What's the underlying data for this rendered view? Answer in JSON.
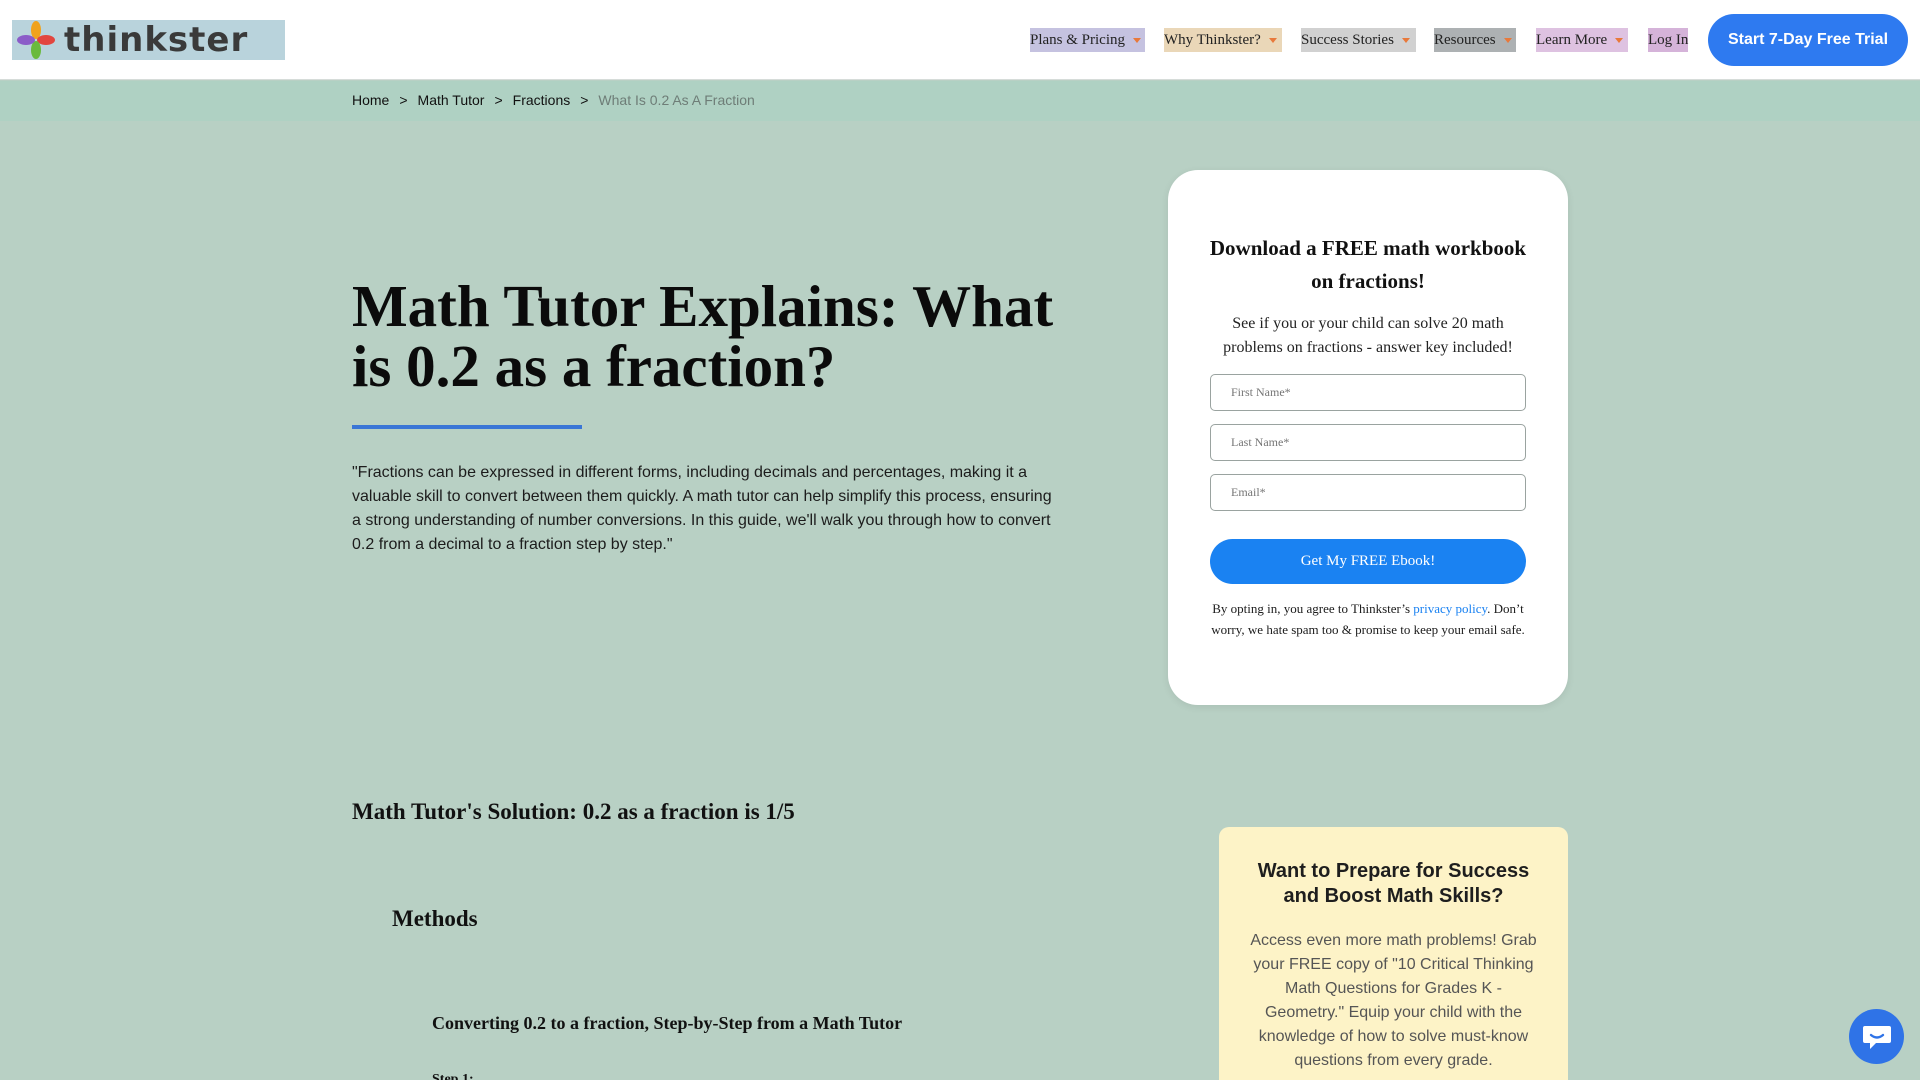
{
  "header": {
    "logo_text": "thinkster",
    "nav": [
      {
        "label": "Plans & Pricing"
      },
      {
        "label": "Why Thinkster?"
      },
      {
        "label": "Success Stories"
      },
      {
        "label": "Resources"
      },
      {
        "label": "Learn More"
      },
      {
        "label": "Log In"
      }
    ],
    "cta_label": "Start 7-Day Free Trial"
  },
  "breadcrumb": {
    "items": [
      "Home",
      "Math Tutor",
      "Fractions",
      "What Is 0.2 As A Fraction"
    ],
    "separator": ">"
  },
  "hero": {
    "title": "Math Tutor Explains: What is 0.2 as a fraction?",
    "description": "\"Fractions can be expressed in different forms, including decimals and percentages, making it a valuable skill to convert between them quickly. A math tutor can help simplify this process, ensuring a strong understanding of number conversions. In this guide, we'll walk you through how to convert 0.2 from a decimal to a fraction step by step.\""
  },
  "ebook_form": {
    "title": "Download a FREE math workbook on fractions!",
    "subtitle": "See if you or your child can solve 20 math problems on fractions - answer key included!",
    "first_name_placeholder": "First Name*",
    "last_name_placeholder": "Last Name*",
    "email_placeholder": "Email*",
    "submit_label": "Get My FREE Ebook!",
    "legal_before": "By opting in, you agree to Thinkster’s ",
    "legal_link": "privacy policy",
    "legal_after": ". Don’t worry, we hate spam too & promise to keep your email safe."
  },
  "solution": {
    "heading": "Math Tutor's Solution: 0.2 as a fraction is 1/5",
    "methods_heading": "Methods",
    "converting_heading": "Converting 0.2 to a fraction, Step-by-Step from a Math Tutor",
    "step_heading": "Step 1:"
  },
  "promo": {
    "title": "Want to Prepare for Success and Boost Math Skills?",
    "text": "Access even more math problems! Grab your FREE copy of \"10 Critical Thinking Math Questions for Grades K - Geometry.\" Equip your child with the knowledge of how to solve must-know questions from every grade."
  },
  "colors": {
    "page_background": "#b8d0c4",
    "accent_blue": "#2e7af0",
    "caret_orange": "#e8793b",
    "promo_background": "#fdf3c7"
  },
  "icons": {
    "logo_mark": "pinwheel-logo-icon",
    "nav_caret": "caret-down-icon",
    "chat": "chat-bubble-icon"
  }
}
